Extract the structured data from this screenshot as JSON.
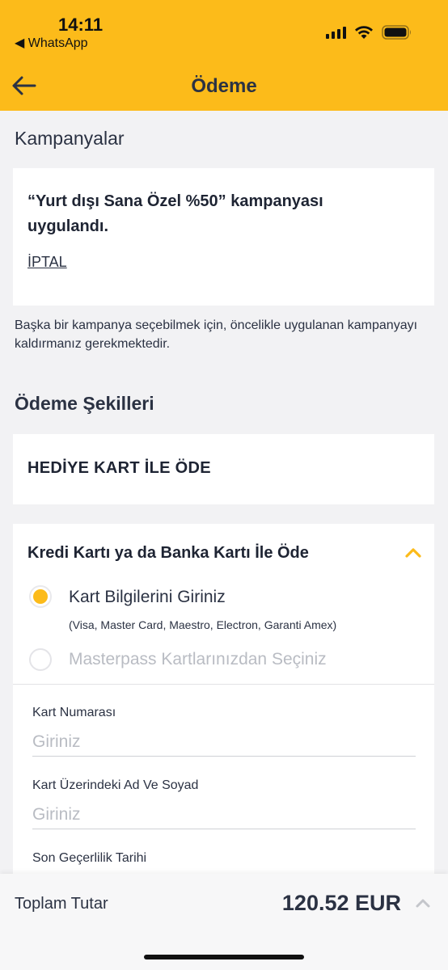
{
  "status_bar": {
    "time": "14:11",
    "back_app": "◀ WhatsApp"
  },
  "header": {
    "title": "Ödeme"
  },
  "campaigns": {
    "section_title": "Kampanyalar",
    "applied_text": "“Yurt dışı Sana Özel %50” kampanyası uygulandı.",
    "cancel_label": "İPTAL",
    "info_text": "Başka bir kampanya seçebilmek için, öncelikle uygulanan kampanyayı kaldırmanız gerekmektedir."
  },
  "payment_methods": {
    "section_title": "Ödeme Şekilleri",
    "gift_card_label": "HEDİYE KART İLE ÖDE",
    "credit_card": {
      "title": "Kredi Kartı ya da Banka Kartı İle Öde",
      "option_enter": "Kart Bilgilerini Giriniz",
      "option_enter_sub": "(Visa, Master Card, Maestro, Electron, Garanti Amex)",
      "option_masterpass": "Masterpass Kartlarınızdan Seçiniz",
      "selected_option": "Kart Bilgilerini Giriniz",
      "fields": [
        {
          "label": "Kart Numarası",
          "placeholder": "Giriniz"
        },
        {
          "label": "Kart Üzerindeki Ad Ve Soyad",
          "placeholder": "Giriniz"
        },
        {
          "label": "Son Geçerlilik Tarihi"
        }
      ]
    }
  },
  "footer": {
    "total_label": "Toplam Tutar",
    "total_value": "120.52 EUR"
  },
  "colors": {
    "accent": "#fcbb1a",
    "text": "#2b3243",
    "muted": "#b9bcc3",
    "background": "#f2f2f4"
  },
  "icons": [
    "back-arrow-icon",
    "chevron-up-icon",
    "signal-icon",
    "wifi-icon",
    "battery-icon"
  ]
}
